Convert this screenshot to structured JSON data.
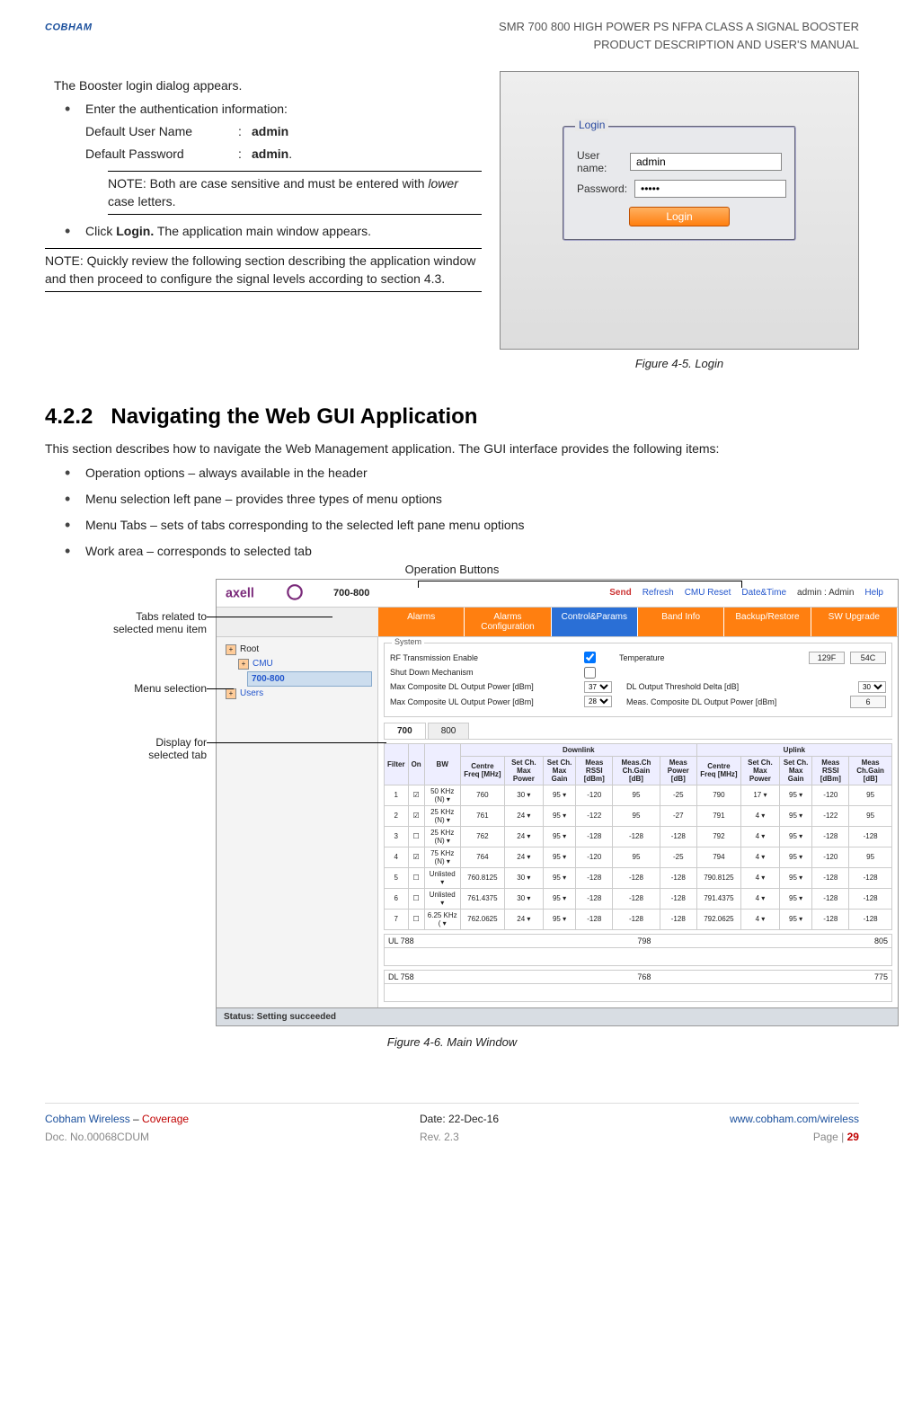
{
  "header": {
    "brand": "COBHAM",
    "doc_title_1": "SMR 700 800 HIGH POWER PS NFPA CLASS A SIGNAL BOOSTER",
    "doc_title_2": "PRODUCT DESCRIPTION AND USER'S MANUAL"
  },
  "login_section": {
    "intro": "The Booster login dialog appears.",
    "bullet1": "Enter the authentication information:",
    "cred_user_label": "Default User Name",
    "cred_user_sep": ":",
    "cred_user_val": "admin",
    "cred_pass_label": "Default Password",
    "cred_pass_sep": ":",
    "cred_pass_val": "admin",
    "cred_pass_dot": ".",
    "note1": "NOTE: Both are case sensitive and must be entered with ",
    "note1_italic": "lower",
    "note1_after": " case letters.",
    "bullet2_pre": "Click ",
    "bullet2_bold": "Login.",
    "bullet2_post": " The application main window appears.",
    "note2": "NOTE: Quickly review the following section describing the application window and then proceed to configure the signal levels according to section 4.3."
  },
  "login_dialog": {
    "legend": "Login",
    "user_label": "User name:",
    "user_value": "admin",
    "pass_label": "Password:",
    "pass_value": "•••••",
    "button": "Login"
  },
  "fig1_caption": "Figure 4-5. Login",
  "section": {
    "num": "4.2.2",
    "title": "Navigating the Web GUI Application",
    "body": "This section describes how to navigate the Web Management application. The GUI interface provides the following items:",
    "items": [
      "Operation options – always available in the header",
      "Menu selection left pane – provides three types of menu options",
      "Menu Tabs – sets of tabs corresponding to the selected left pane menu options",
      "Work area – corresponds to selected tab"
    ]
  },
  "annotations": {
    "op_buttons": "Operation Buttons",
    "tabs_related_1": "Tabs related to",
    "tabs_related_2": "selected menu item",
    "menu_sel": "Menu selection",
    "display_1": "Display for",
    "display_2": "selected tab"
  },
  "main_window": {
    "title": "700-800",
    "ops": [
      "Send",
      "Refresh",
      "CMU Reset",
      "Date&Time"
    ],
    "user_info": "admin : Admin",
    "help": "Help",
    "tabs": [
      {
        "label": "Alarms",
        "bg": "#ff7f10"
      },
      {
        "label": "Alarms Configuration",
        "bg": "#ff7f10"
      },
      {
        "label": "Control&Params",
        "bg": "#2a6fd6"
      },
      {
        "label": "Band Info",
        "bg": "#ff7f10"
      },
      {
        "label": "Backup/Restore",
        "bg": "#ff7f10"
      },
      {
        "label": "SW Upgrade",
        "bg": "#ff7f10"
      }
    ],
    "tree": {
      "root": "Root",
      "cmu": "CMU",
      "band": "700-800",
      "users": "Users"
    },
    "system": {
      "legend": "System",
      "rf_enable": "RF Transmission Enable",
      "rf_checked": true,
      "temp_label": "Temperature",
      "temp_f": "129F",
      "temp_c": "54C",
      "shutdown": "Shut Down Mechanism",
      "shutdown_checked": false,
      "max_dl": "Max Composite DL Output Power [dBm]",
      "max_dl_val": "37",
      "dl_thresh": "DL Output Threshold Delta [dB]",
      "dl_thresh_val": "30",
      "max_ul": "Max Composite UL Output Power [dBm]",
      "max_ul_val": "28",
      "meas_dl": "Meas. Composite DL Output Power [dBm]",
      "meas_dl_val": "6"
    },
    "sub_tabs": [
      "700",
      "800"
    ],
    "table": {
      "group_dl": "Downlink",
      "group_ul": "Uplink",
      "headers": [
        "Filter",
        "On",
        "BW",
        "Centre Freq [MHz]",
        "Set Ch. Max Power",
        "Set Ch. Max Gain",
        "Meas RSSI [dBm]",
        "Meas.Ch Ch.Gain [dB]",
        "Meas Power [dB]",
        "Centre Freq [MHz]",
        "Set Ch. Max Power",
        "Set Ch. Max Gain",
        "Meas RSSI [dBm]",
        "Meas Ch.Gain [dB]"
      ],
      "rows": [
        {
          "f": "1",
          "on": true,
          "bw": "50 KHz (N)",
          "dl": [
            "760",
            "30",
            "95",
            "-120",
            "95",
            "-25"
          ],
          "ul": [
            "790",
            "17",
            "95",
            "-120",
            "95"
          ]
        },
        {
          "f": "2",
          "on": true,
          "bw": "25 KHz (N)",
          "dl": [
            "761",
            "24",
            "95",
            "-122",
            "95",
            "-27"
          ],
          "ul": [
            "791",
            "4",
            "95",
            "-122",
            "95"
          ]
        },
        {
          "f": "3",
          "on": false,
          "bw": "25 KHz (N)",
          "dl": [
            "762",
            "24",
            "95",
            "-128",
            "-128",
            "-128"
          ],
          "ul": [
            "792",
            "4",
            "95",
            "-128",
            "-128"
          ]
        },
        {
          "f": "4",
          "on": true,
          "bw": "75 KHz (N)",
          "dl": [
            "764",
            "24",
            "95",
            "-120",
            "95",
            "-25"
          ],
          "ul": [
            "794",
            "4",
            "95",
            "-120",
            "95"
          ]
        },
        {
          "f": "5",
          "on": false,
          "bw": "Unlisted",
          "dl": [
            "760.8125",
            "30",
            "95",
            "-128",
            "-128",
            "-128"
          ],
          "ul": [
            "790.8125",
            "4",
            "95",
            "-128",
            "-128"
          ]
        },
        {
          "f": "6",
          "on": false,
          "bw": "Unlisted",
          "dl": [
            "761.4375",
            "30",
            "95",
            "-128",
            "-128",
            "-128"
          ],
          "ul": [
            "791.4375",
            "4",
            "95",
            "-128",
            "-128"
          ]
        },
        {
          "f": "7",
          "on": false,
          "bw": "6.25 KHz (",
          "dl": [
            "762.0625",
            "24",
            "95",
            "-128",
            "-128",
            "-128"
          ],
          "ul": [
            "792.0625",
            "4",
            "95",
            "-128",
            "-128"
          ]
        }
      ]
    },
    "ul_row": {
      "label_l": "UL 788",
      "mid": "798",
      "right": "805"
    },
    "dl_row": {
      "label_l": "DL 758",
      "mid": "768",
      "right": "775"
    },
    "status": "Status: Setting succeeded"
  },
  "fig2_caption": "Figure 4-6. Main Window",
  "footer": {
    "brand": "Cobham Wireless",
    "dash": " – ",
    "coverage": "Coverage",
    "date_label": "Date: ",
    "date": "22-Dec-16",
    "url": "www.cobham.com/wireless",
    "doc_label": "Doc. No.",
    "doc_no": "00068CDUM",
    "rev_label": "Rev. ",
    "rev": "2.3",
    "page_label": "Page | ",
    "page_no": "29"
  }
}
